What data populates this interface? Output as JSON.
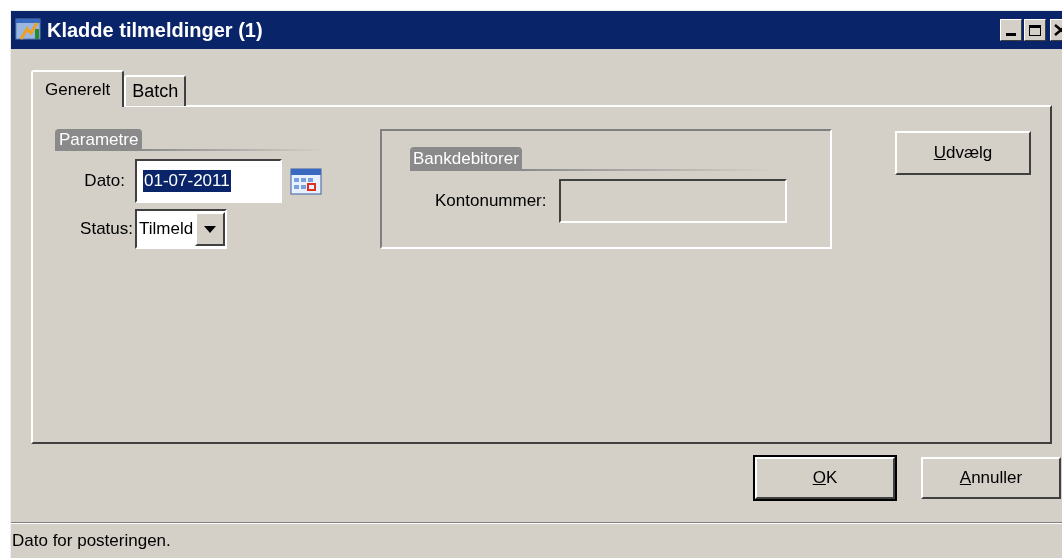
{
  "window": {
    "title": "Kladde tilmeldinger (1)"
  },
  "tabs": [
    {
      "label": "Generelt",
      "selected": true
    },
    {
      "label": "Batch",
      "selected": false
    }
  ],
  "parameters": {
    "heading": "Parametre",
    "date": {
      "label": "Dato:",
      "value": "01-07-2011",
      "text_selected": true
    },
    "status": {
      "label": "Status:",
      "value": "Tilmeld"
    }
  },
  "bank_debtors": {
    "heading": "Bankdebitorer",
    "account": {
      "label": "Kontonummer:",
      "disabled": true
    }
  },
  "select_button": {
    "label": "Udvælg",
    "mnemonic": true,
    "default": false
  },
  "buttons": [
    {
      "label": "OK",
      "mnemonic": true,
      "default": true
    },
    {
      "label": "Annuller",
      "mnemonic": true,
      "default": false
    }
  ],
  "status_bar": "Dato for posteringen."
}
